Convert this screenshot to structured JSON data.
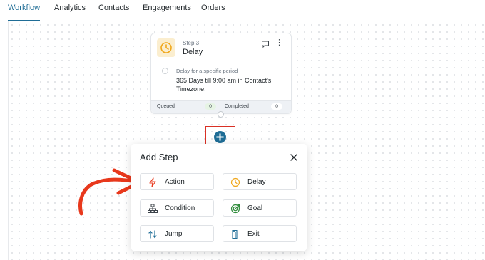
{
  "tabs": [
    {
      "label": "Workflow",
      "active": true
    },
    {
      "label": "Analytics"
    },
    {
      "label": "Contacts"
    },
    {
      "label": "Engagements"
    },
    {
      "label": "Orders"
    }
  ],
  "step_card": {
    "step_number": "Step 3",
    "title": "Delay",
    "sub_label": "Delay for a specific period",
    "description": "365 Days till 9:00 am in Contact's Timezone.",
    "queued_label": "Queued",
    "queued_count": "0",
    "completed_label": "Completed",
    "completed_count": "0"
  },
  "add_step_panel": {
    "title": "Add Step",
    "options": [
      {
        "label": "Action",
        "icon": "lightning-icon"
      },
      {
        "label": "Delay",
        "icon": "clock-icon"
      },
      {
        "label": "Condition",
        "icon": "hierarchy-icon"
      },
      {
        "label": "Goal",
        "icon": "target-icon"
      },
      {
        "label": "Jump",
        "icon": "jump-icon"
      },
      {
        "label": "Exit",
        "icon": "exit-icon"
      }
    ]
  },
  "colors": {
    "accent": "#1f6d96",
    "annotation_red": "#e8381c",
    "delay_orange": "#f0a71b",
    "goal_green": "#2e8b3a"
  }
}
